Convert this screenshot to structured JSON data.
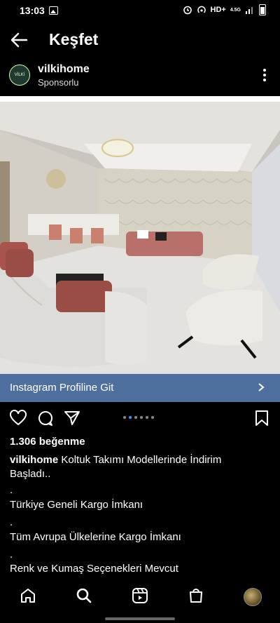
{
  "status": {
    "time": "13:03",
    "network": "HD+",
    "net_small": "4.5G"
  },
  "header": {
    "title": "Keşfet"
  },
  "post": {
    "username": "vilkihome",
    "sponsored": "Sponsorlu",
    "avatar_text": "VİLKİ"
  },
  "cta": {
    "label": "Instagram Profiline Git"
  },
  "stats": {
    "likes": "1.306 beğenme"
  },
  "caption": {
    "username": "vilkihome",
    "line1": "Koltuk Takımı Modellerinde İndirim",
    "line2": "Başladı..",
    "dot": ".",
    "line3": "Türkiye Geneli Kargo İmkanı",
    "line4": "Tüm Avrupa Ülkelerine Kargo İmkanı",
    "line5": "Renk ve Kumaş Seçenekleri Mevcut"
  },
  "icons": {
    "back": "arrow-left-icon",
    "more": "more-vertical-icon",
    "like": "heart-icon",
    "comment": "comment-icon",
    "share": "share-icon",
    "save": "bookmark-icon",
    "home": "home-icon",
    "search": "search-icon",
    "reels": "reels-icon",
    "shop": "shop-icon"
  }
}
